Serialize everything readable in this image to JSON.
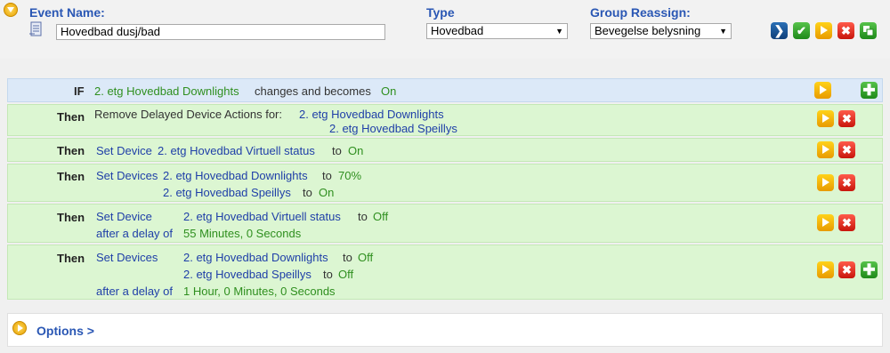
{
  "header": {
    "event_name_label": "Event Name:",
    "event_name_value": "Hovedbad dusj/bad",
    "type_label": "Type",
    "type_value": "Hovedbad",
    "group_label": "Group Reassign:",
    "group_value": "Bevegelse belysning"
  },
  "if_row": {
    "keyword": "IF",
    "device": "2. etg Hovedbad Downlights",
    "text": "changes and becomes",
    "state": "On"
  },
  "then1": {
    "keyword": "Then",
    "action": "Remove Delayed Device Actions for:",
    "device1": "2. etg Hovedbad Downlights",
    "device2": "2. etg Hovedbad Speillys"
  },
  "then2": {
    "keyword": "Then",
    "action": "Set Device",
    "device": "2. etg Hovedbad Virtuell status",
    "to": "to",
    "value": "On"
  },
  "then3": {
    "keyword": "Then",
    "action": "Set Devices",
    "device1": "2. etg Hovedbad Downlights",
    "to1": "to",
    "value1": "70%",
    "device2": "2. etg Hovedbad Speillys",
    "to2": "to",
    "value2": "On"
  },
  "then4": {
    "keyword": "Then",
    "action": "Set Device",
    "device": "2. etg Hovedbad Virtuell status",
    "to": "to",
    "value": "Off",
    "delay_label": "after a delay of",
    "delay_value": "55 Minutes, 0 Seconds"
  },
  "then5": {
    "keyword": "Then",
    "action": "Set Devices",
    "device1": "2. etg Hovedbad Downlights",
    "to1": "to",
    "value1": "Off",
    "device2": "2. etg Hovedbad Speillys",
    "to2": "to",
    "value2": "Off",
    "delay_label": "after a delay of",
    "delay_value": "1 Hour, 0 Minutes, 0 Seconds"
  },
  "options": {
    "label": "Options >"
  },
  "icons": {
    "collapse": "chevron-down-circle-icon",
    "event_doc": "document-icon",
    "next": "arrow-right-icon",
    "save": "check-icon",
    "play": "play-icon",
    "delete": "x-icon",
    "add": "plus-icon",
    "copy": "copy-icon"
  },
  "colors": {
    "label_blue": "#2a57b4",
    "value_green": "#2f8f1f",
    "if_bg": "#dce9f8",
    "then_bg": "#dcf6d2",
    "play": "#f2b400",
    "delete": "#e1261a",
    "add": "#1f9a1a"
  }
}
